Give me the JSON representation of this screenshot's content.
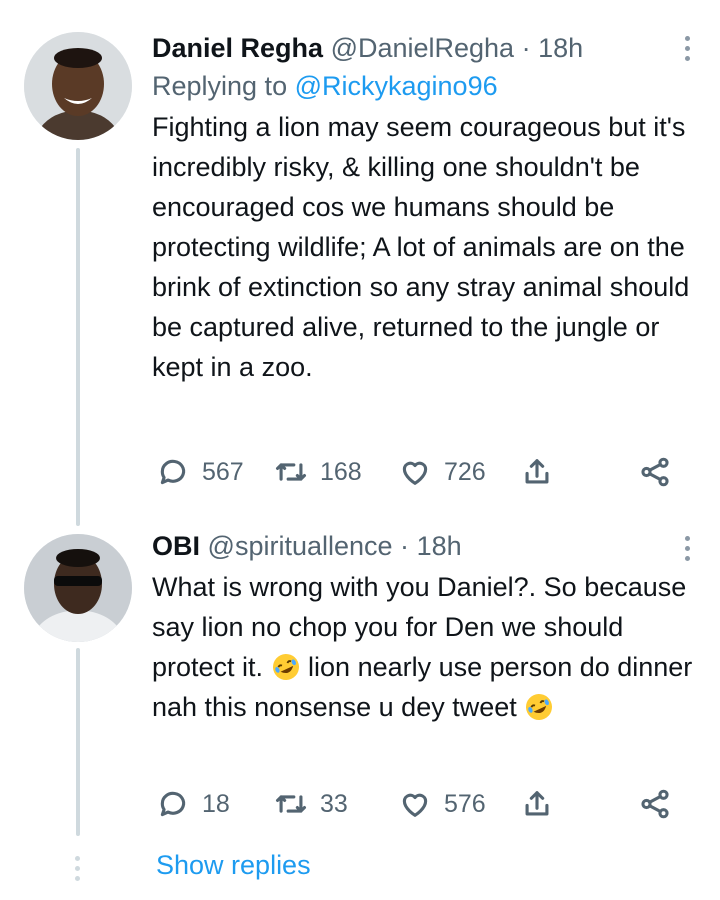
{
  "tweets": [
    {
      "name": "Daniel Regha",
      "handle": "@DanielRegha",
      "separator": "·",
      "time": "18h",
      "replying_prefix": "Replying to",
      "replying_to": "@Rickykagino96",
      "text": "Fighting a lion may seem courageous but it's incredibly risky, & killing one shouldn't be encouraged cos we humans should be protecting wildlife; A lot of animals are on the brink of extinction so any stray animal should be captured alive, returned to the jungle or kept in a zoo.",
      "replies": "567",
      "retweets": "168",
      "likes": "726"
    },
    {
      "name": "OBI",
      "handle": "@spirituallence",
      "separator": "·",
      "time": "18h",
      "text_1": "What is wrong with you Daniel?. So because say lion no chop you for Den we should protect it. ",
      "text_2": " lion nearly use person do dinner nah this nonsense u dey tweet ",
      "replies": "18",
      "retweets": "33",
      "likes": "576"
    }
  ],
  "show_replies": "Show replies",
  "colors": {
    "accent": "#1d9bf0",
    "secondary_text": "#536471",
    "thread_line": "#cfd9de"
  },
  "icons": [
    "reply-icon",
    "retweet-icon",
    "like-icon",
    "share-icon",
    "more-icon",
    "rofl-emoji"
  ]
}
